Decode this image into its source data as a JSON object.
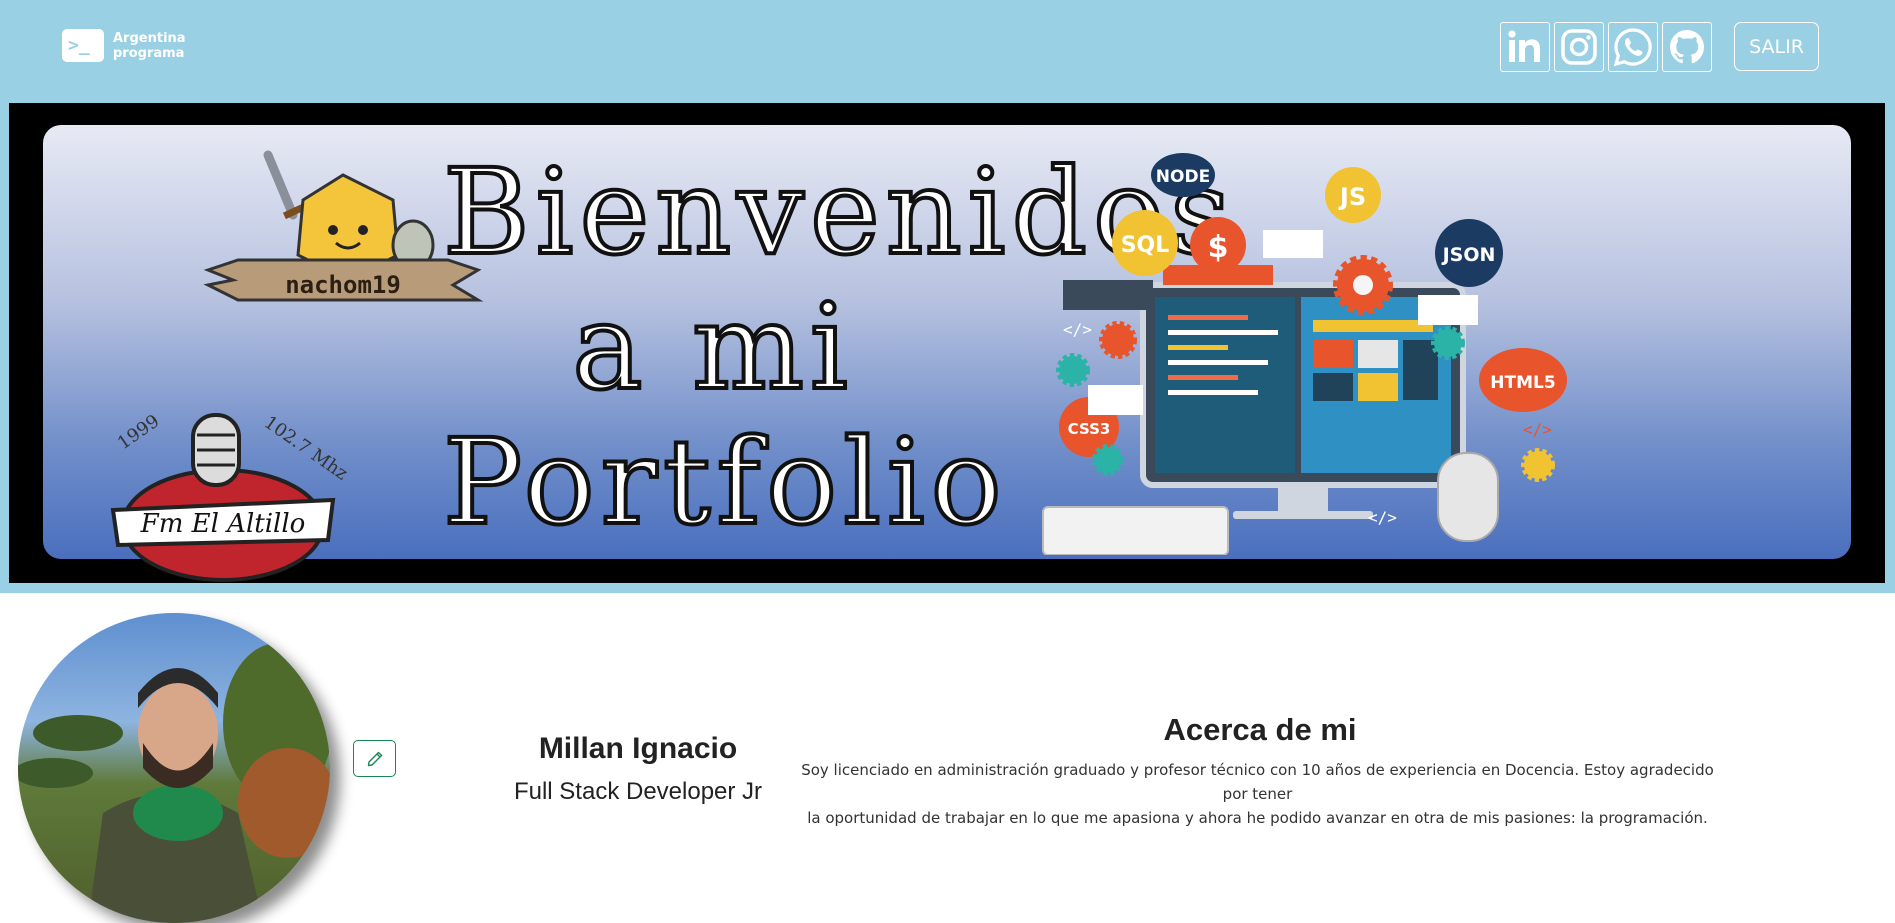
{
  "header": {
    "logo": {
      "line1": "Argentina",
      "line2": "programa",
      "mark": ">_"
    },
    "socials": [
      {
        "name": "linkedin",
        "icon": "linkedin-icon"
      },
      {
        "name": "instagram",
        "icon": "instagram-icon"
      },
      {
        "name": "whatsapp",
        "icon": "whatsapp-icon"
      },
      {
        "name": "github",
        "icon": "github-icon"
      }
    ],
    "logout_label": "SALIR"
  },
  "banner": {
    "title_lines": [
      "Bienvenidos",
      "a mi",
      "Portfolio"
    ],
    "badge_nachom": "nachom19",
    "badge_fm": "Fm El Altillo",
    "badge_fm_year": "1999",
    "badge_fm_freq": "102.7 Mhz",
    "tech_labels": [
      "NODE",
      "JS",
      "SQL",
      "JSON",
      "HTML5",
      "CSS3",
      "</>"
    ]
  },
  "profile": {
    "name": "Millan Ignacio",
    "role": "Full Stack Developer Jr",
    "edit_icon": "pencil-icon"
  },
  "about": {
    "title": "Acerca de mi",
    "text_line1": "Soy licenciado en administración graduado y profesor técnico con 10 años de experiencia en Docencia. Estoy agradecido por tener",
    "text_line2": "la oportunidad de trabajar en lo que me apasiona y ahora he podido avanzar en otra de mis pasiones: la programación."
  },
  "colors": {
    "header_bg": "#99d0e3",
    "edit_border": "#198754"
  }
}
